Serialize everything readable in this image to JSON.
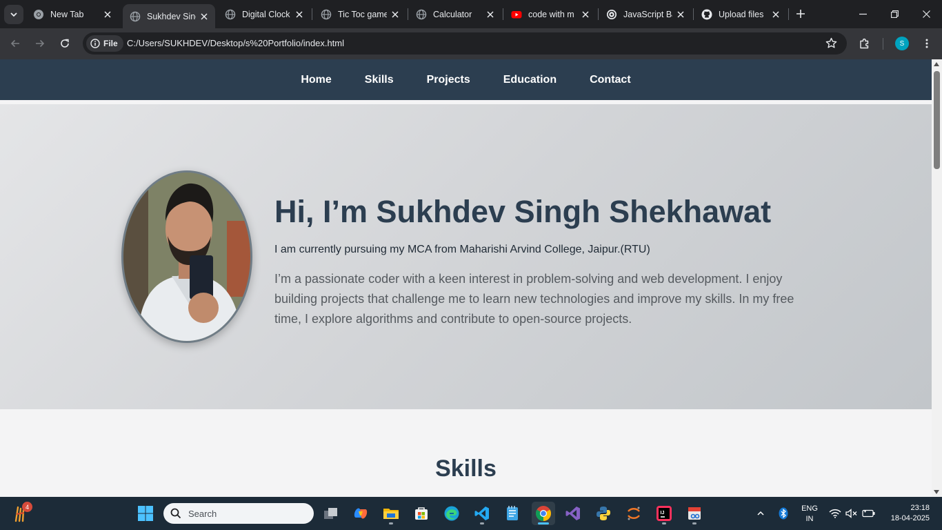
{
  "browser": {
    "tabs": [
      {
        "title": "New Tab",
        "icon": "chrome-icon",
        "active": false
      },
      {
        "title": "Sukhdev Singh",
        "icon": "globe-icon",
        "active": true
      },
      {
        "title": "Digital Clock",
        "icon": "globe-icon",
        "active": false
      },
      {
        "title": "Tic Toc game",
        "icon": "globe-icon",
        "active": false
      },
      {
        "title": "Calculator",
        "icon": "globe-icon",
        "active": false
      },
      {
        "title": "code with m",
        "icon": "youtube-icon",
        "active": false
      },
      {
        "title": "JavaScript Ba",
        "icon": "chatgpt-icon",
        "active": false
      },
      {
        "title": "Upload files",
        "icon": "github-icon",
        "active": false
      }
    ],
    "chip_label": "File",
    "url": "C:/Users/SUKHDEV/Desktop/s%20Portfolio/index.html",
    "profile_initial": "S"
  },
  "site": {
    "nav": [
      "Home",
      "Skills",
      "Projects",
      "Education",
      "Contact"
    ],
    "hero": {
      "title": "Hi, I’m Sukhdev Singh Shekhawat",
      "subtitle": "I am currently pursuing my MCA from Maharishi Arvind College, Jaipur.(RTU)",
      "description": "I’m a passionate coder with a keen interest in problem-solving and web development. I enjoy building projects that challenge me to learn new technologies and improve my skills. In my free time, I explore algorithms and contribute to open-source projects."
    },
    "skills_heading": "Skills"
  },
  "taskbar": {
    "widget_badge": "4",
    "search_placeholder": "Search",
    "lang": "ENG",
    "region": "IN",
    "time": "23:18",
    "date": "18-04-2025"
  },
  "colors": {
    "nav_bg": "#2c3e50",
    "title_color": "#2c3e50",
    "taskbar_bg": "#1c2b38"
  }
}
